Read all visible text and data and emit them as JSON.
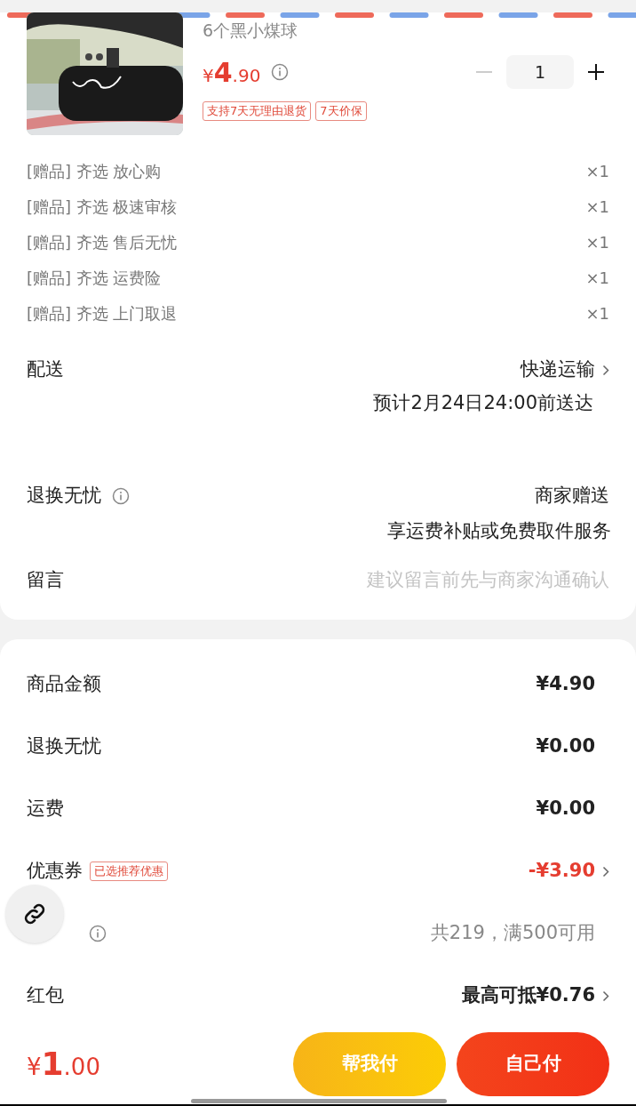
{
  "product": {
    "name": "6个黑小煤球",
    "price_symbol": "¥",
    "price_int": "4",
    "price_dec": ".90",
    "quantity": "1",
    "minus_disabled": true,
    "tags": [
      "支持7天无理由退货",
      "7天价保"
    ]
  },
  "gifts": [
    {
      "label": "[赠品] 齐选 放心购",
      "count": "×1"
    },
    {
      "label": "[赠品] 齐选 极速审核",
      "count": "×1"
    },
    {
      "label": "[赠品] 齐选 售后无忧",
      "count": "×1"
    },
    {
      "label": "[赠品] 齐选 运费险",
      "count": "×1"
    },
    {
      "label": "[赠品] 齐选 上门取退",
      "count": "×1"
    }
  ],
  "delivery": {
    "label": "配送",
    "value": "快递运输",
    "note": "预计2月24日24:00前送达"
  },
  "return_service": {
    "label": "退换无忧",
    "value": "商家赠送",
    "note": "享运费补贴或免费取件服务"
  },
  "message": {
    "label": "留言",
    "placeholder": "建议留言前先与商家沟通确认"
  },
  "summary": [
    {
      "kind": "plain",
      "label": "商品金额",
      "value": "¥4.90",
      "arrow": false
    },
    {
      "kind": "plain",
      "label": "退换无忧",
      "value": "¥0.00",
      "arrow": false
    },
    {
      "kind": "plain",
      "label": "运费",
      "value": "¥0.00",
      "arrow": false
    },
    {
      "kind": "discount",
      "label": "优惠券",
      "tag": "已选推荐优惠",
      "value": "-¥3.90",
      "arrow": true
    },
    {
      "kind": "points",
      "value": "共219，满500可用",
      "arrow": false
    },
    {
      "kind": "plain",
      "label": "红包",
      "value": "最高可抵¥0.76",
      "arrow": true
    }
  ],
  "footer": {
    "price_symbol": "¥",
    "price_int": "1",
    "price_dec": ".00",
    "buttons": [
      {
        "kind": "friend",
        "label": "帮我付"
      },
      {
        "kind": "self",
        "label": "自己付"
      }
    ]
  }
}
